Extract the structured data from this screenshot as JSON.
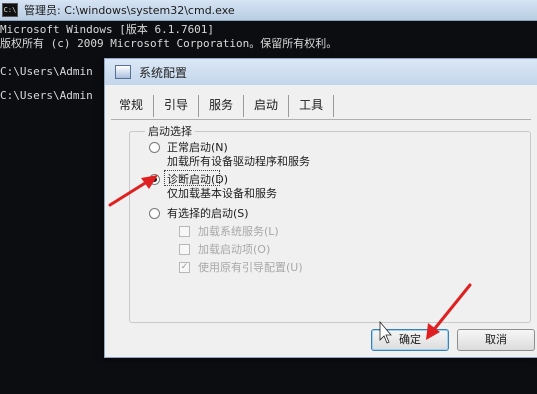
{
  "cmd": {
    "window_title": "管理员: C:\\windows\\system32\\cmd.exe",
    "lines": [
      "Microsoft Windows [版本 6.1.7601]",
      "版权所有 (c) 2009 Microsoft Corporation。保留所有权利。",
      "C:\\Users\\Admin",
      "C:\\Users\\Admin"
    ]
  },
  "dialog": {
    "title": "系统配置",
    "tabs": [
      "常规",
      "引导",
      "服务",
      "启动",
      "工具"
    ],
    "startup_group": {
      "legend": "启动选择",
      "options": [
        {
          "label": "正常启动(N)",
          "description": "加载所有设备驱动程序和服务",
          "checked": false
        },
        {
          "label": "诊断启动(D)",
          "description": "仅加载基本设备和服务",
          "checked": true
        },
        {
          "label": "有选择的启动(S)",
          "checked": false
        }
      ],
      "sub_options": [
        {
          "label": "加载系统服务(L)",
          "checked": false,
          "enabled": false
        },
        {
          "label": "加载启动项(O)",
          "checked": false,
          "enabled": false
        },
        {
          "label": "使用原有引导配置(U)",
          "checked": true,
          "enabled": false
        }
      ]
    },
    "buttons": {
      "ok": "确定",
      "cancel": "取消"
    }
  },
  "colors": {
    "annotation_arrow": "#e02020",
    "console_background": "#0b0d10",
    "dialog_background": "#f0f0f0"
  },
  "icons": [
    "cmd-window-icon",
    "system-config-icon",
    "mouse-cursor-icon",
    "red-arrow-annotation"
  ]
}
